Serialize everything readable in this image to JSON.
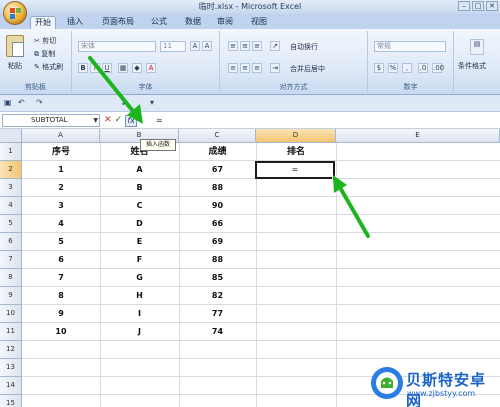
{
  "window": {
    "title": "临时.xlsx - Microsoft Excel"
  },
  "ribbon_tabs": [
    "开始",
    "插入",
    "页面布局",
    "公式",
    "数据",
    "审阅",
    "视图"
  ],
  "ribbon": {
    "clipboard": {
      "paste": "粘贴",
      "cut": "剪切",
      "copy": "复制",
      "format_painter": "格式刷",
      "label": "剪贴板"
    },
    "font": {
      "name": "宋体",
      "size": "11",
      "label": "字体",
      "bold": "B",
      "italic": "I",
      "underline": "U"
    },
    "alignment": {
      "wrap": "自动换行",
      "merge": "合并后居中",
      "label": "对齐方式"
    },
    "number": {
      "format": "常规",
      "label": "数字"
    },
    "styles": {
      "conditional": "条件格式"
    }
  },
  "formula_bar": {
    "name_box": "SUBTOTAL",
    "cancel": "✕",
    "enter": "✓",
    "fx": "fx",
    "value": "=",
    "tooltip": "插入函数"
  },
  "columns": [
    "A",
    "B",
    "C",
    "D",
    "E"
  ],
  "rows": [
    "1",
    "2",
    "3",
    "4",
    "5",
    "6",
    "7",
    "8",
    "9",
    "10",
    "11",
    "12",
    "13",
    "14",
    "15"
  ],
  "headers": [
    "序号",
    "姓名",
    "成绩",
    "排名"
  ],
  "table": [
    [
      "1",
      "A",
      "67"
    ],
    [
      "2",
      "B",
      "88"
    ],
    [
      "3",
      "C",
      "90"
    ],
    [
      "4",
      "D",
      "66"
    ],
    [
      "5",
      "E",
      "69"
    ],
    [
      "6",
      "F",
      "88"
    ],
    [
      "7",
      "G",
      "85"
    ],
    [
      "8",
      "H",
      "82"
    ],
    [
      "9",
      "I",
      "77"
    ],
    [
      "10",
      "J",
      "74"
    ]
  ],
  "active_cell": {
    "ref": "D2",
    "value": "="
  },
  "watermark": {
    "title": "贝斯特安卓网",
    "url": "www.zjbstyy.com"
  },
  "colors": {
    "arrow": "#1db51d",
    "accent": "#1d63c6"
  }
}
